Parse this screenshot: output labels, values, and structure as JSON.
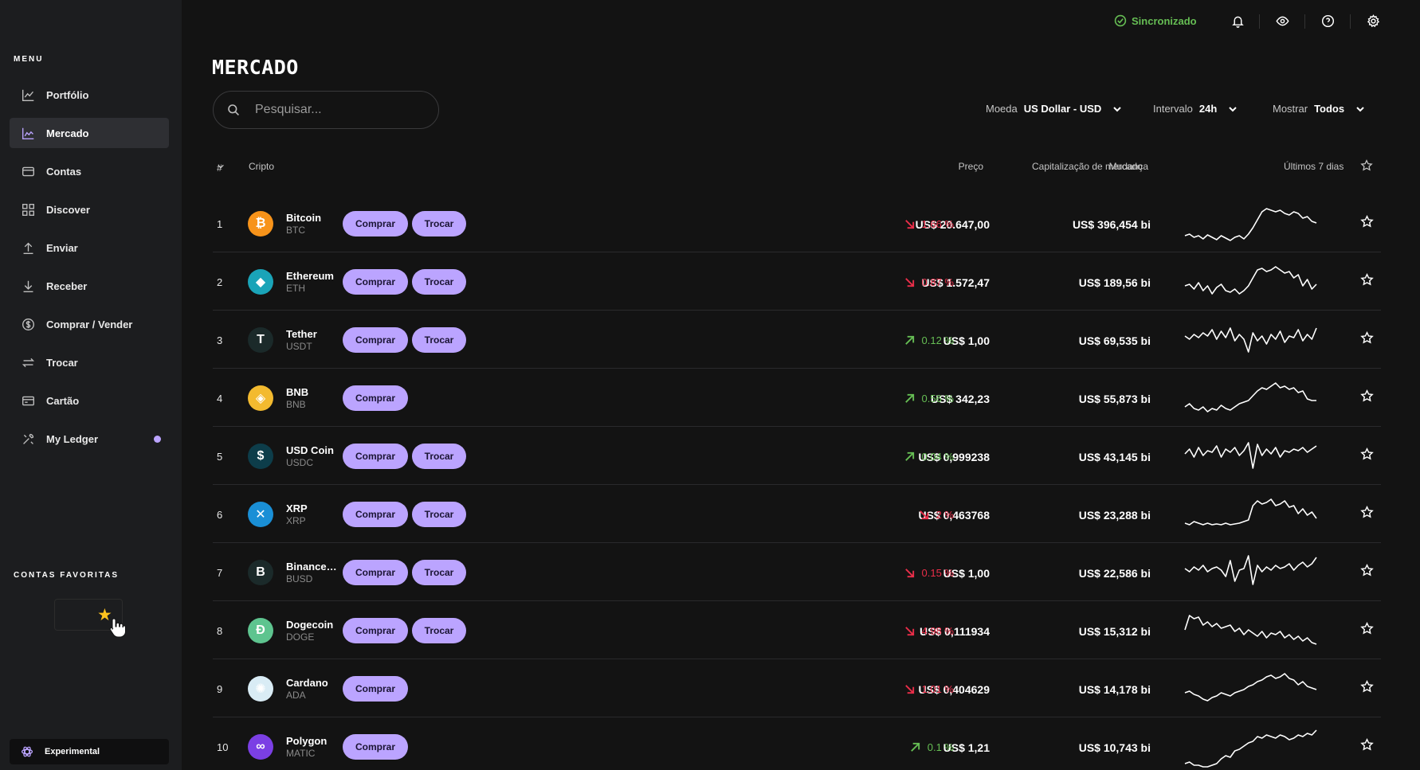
{
  "colors": {
    "accent": "#bba4ff",
    "up": "#66be54",
    "down": "#ea2e49",
    "background": "#131313",
    "sidebar": "#1c1d1f"
  },
  "sidebar": {
    "menu_title": "MENU",
    "items": [
      {
        "label": "Portfólio",
        "icon": "chart-line-icon"
      },
      {
        "label": "Mercado",
        "icon": "market-chart-icon"
      },
      {
        "label": "Contas",
        "icon": "wallet-icon"
      },
      {
        "label": "Discover",
        "icon": "grid-icon"
      },
      {
        "label": "Enviar",
        "icon": "arrow-up-icon"
      },
      {
        "label": "Receber",
        "icon": "arrow-down-icon"
      },
      {
        "label": "Comprar / Vender",
        "icon": "dollar-circle-icon"
      },
      {
        "label": "Trocar",
        "icon": "swap-icon"
      },
      {
        "label": "Cartão",
        "icon": "card-icon"
      },
      {
        "label": "My Ledger",
        "icon": "tools-icon"
      }
    ],
    "favorites_title": "CONTAS FAVORITAS",
    "experimental_label": "Experimental"
  },
  "topbar": {
    "sync_label": "Sincronizado"
  },
  "main": {
    "title": "MERCADO",
    "search_placeholder": "Pesquisar...",
    "filters": {
      "currency_label": "Moeda",
      "currency_value": "US Dollar - USD",
      "interval_label": "Intervalo",
      "interval_value": "24h",
      "show_label": "Mostrar",
      "show_value": "Todos"
    },
    "columns": {
      "rank": "#",
      "crypto": "Cripto",
      "price": "Preço",
      "change": "Mudança",
      "market_cap": "Capitalização de mercado",
      "last7": "Últimos 7 dias"
    },
    "buy_label": "Comprar",
    "swap_label": "Trocar"
  },
  "rows": [
    {
      "rank": "1",
      "name": "Bitcoin",
      "ticker": "BTC",
      "price": "US$ 20.647,00",
      "change": "1.66 %",
      "dir": "down",
      "cap": "US$ 396,454 bi",
      "swap": true,
      "icon_bg": "#f7931a",
      "glyph": "₿",
      "spark": [
        40,
        38,
        42,
        40,
        44,
        39,
        42,
        45,
        40,
        43,
        46,
        42,
        40,
        44,
        38,
        30,
        20,
        10,
        6,
        8,
        10,
        8,
        12,
        14,
        10,
        12,
        18,
        16,
        22,
        24
      ]
    },
    {
      "rank": "2",
      "name": "Ethereum",
      "ticker": "ETH",
      "price": "US$ 1.572,47",
      "change": "0.87 %",
      "dir": "down",
      "cap": "US$ 189,56 bi",
      "swap": true,
      "icon_bg": "#1aa4b8",
      "glyph": "◆",
      "spark": [
        30,
        28,
        34,
        26,
        36,
        30,
        40,
        32,
        28,
        36,
        38,
        34,
        40,
        36,
        30,
        20,
        10,
        8,
        12,
        10,
        6,
        10,
        14,
        12,
        20,
        16,
        30,
        22,
        34,
        28
      ]
    },
    {
      "rank": "3",
      "name": "Tether",
      "ticker": "USDT",
      "price": "US$ 1,00",
      "change": "0.12 %",
      "dir": "up",
      "cap": "US$ 69,535 bi",
      "swap": true,
      "icon_bg": "#1b2a2a",
      "glyph": "T",
      "spark": [
        20,
        24,
        18,
        22,
        16,
        20,
        12,
        24,
        14,
        22,
        10,
        26,
        18,
        24,
        40,
        16,
        26,
        20,
        30,
        18,
        24,
        14,
        28,
        20,
        22,
        12,
        26,
        18,
        24,
        10
      ]
    },
    {
      "rank": "4",
      "name": "BNB",
      "ticker": "BNB",
      "price": "US$ 342,23",
      "change": "0.56 %",
      "dir": "up",
      "cap": "US$ 55,873 bi",
      "swap": false,
      "icon_bg": "#f3ba2f",
      "glyph": "◈",
      "spark": [
        36,
        32,
        38,
        40,
        36,
        42,
        38,
        40,
        34,
        38,
        40,
        36,
        32,
        30,
        28,
        22,
        16,
        12,
        14,
        10,
        6,
        12,
        10,
        14,
        12,
        18,
        16,
        26,
        28,
        28
      ]
    },
    {
      "rank": "5",
      "name": "USD Coin",
      "ticker": "USDC",
      "price": "US$ 0,999238",
      "change": "0.04 %",
      "dir": "up",
      "cap": "US$ 43,145 bi",
      "swap": true,
      "icon_bg": "#0d3d4a",
      "glyph": "$",
      "spark": [
        22,
        16,
        26,
        14,
        24,
        18,
        20,
        12,
        26,
        16,
        20,
        14,
        24,
        18,
        8,
        40,
        10,
        24,
        16,
        22,
        14,
        26,
        18,
        20,
        16,
        18,
        14,
        20,
        16,
        12
      ]
    },
    {
      "rank": "6",
      "name": "XRP",
      "ticker": "XRP",
      "price": "US$ 0,463768",
      "change": "2 %",
      "dir": "down",
      "cap": "US$ 23,288 bi",
      "swap": true,
      "icon_bg": "#1a8fd6",
      "glyph": "✕",
      "spark": [
        36,
        38,
        34,
        36,
        38,
        36,
        38,
        37,
        38,
        36,
        38,
        37,
        36,
        34,
        32,
        14,
        8,
        12,
        10,
        6,
        14,
        12,
        8,
        16,
        14,
        24,
        18,
        26,
        22,
        30
      ]
    },
    {
      "rank": "7",
      "name": "Binance USD",
      "ticker": "BUSD",
      "price": "US$ 1,00",
      "change": "0.15 %",
      "dir": "down",
      "cap": "US$ 22,586 bi",
      "swap": true,
      "icon_bg": "#1b2a2a",
      "glyph": "B",
      "spark": [
        20,
        24,
        18,
        22,
        16,
        24,
        20,
        18,
        22,
        30,
        10,
        36,
        22,
        20,
        4,
        40,
        16,
        24,
        18,
        22,
        16,
        20,
        18,
        14,
        22,
        16,
        12,
        18,
        14,
        6
      ]
    },
    {
      "rank": "8",
      "name": "Dogecoin",
      "ticker": "DOGE",
      "price": "US$ 0,111934",
      "change": "4.98 %",
      "dir": "down",
      "cap": "US$ 15,312 bi",
      "swap": true,
      "icon_bg": "#5ec48f",
      "glyph": "Ð",
      "spark": [
        24,
        6,
        10,
        8,
        18,
        14,
        20,
        16,
        22,
        20,
        18,
        26,
        22,
        30,
        24,
        28,
        32,
        26,
        34,
        28,
        30,
        26,
        34,
        30,
        36,
        32,
        38,
        34,
        40,
        42
      ]
    },
    {
      "rank": "9",
      "name": "Cardano",
      "ticker": "ADA",
      "price": "US$ 0,404629",
      "change": "1.01 %",
      "dir": "down",
      "cap": "US$ 14,178 bi",
      "swap": false,
      "icon_bg": "#d9ecf5",
      "glyph": "✺",
      "spark": [
        30,
        28,
        32,
        34,
        38,
        40,
        36,
        34,
        30,
        32,
        34,
        30,
        28,
        26,
        22,
        20,
        16,
        14,
        10,
        8,
        12,
        10,
        6,
        12,
        14,
        20,
        16,
        22,
        24,
        26
      ]
    },
    {
      "rank": "10",
      "name": "Polygon",
      "ticker": "MATIC",
      "price": "US$ 1,21",
      "change": "0.1 %",
      "dir": "up",
      "cap": "US$ 10,743 bi",
      "swap": false,
      "icon_bg": "#7b3fe4",
      "glyph": "∞",
      "spark": [
        46,
        44,
        48,
        48,
        50,
        50,
        48,
        46,
        40,
        36,
        38,
        30,
        28,
        24,
        20,
        18,
        12,
        14,
        10,
        12,
        14,
        10,
        12,
        16,
        14,
        10,
        12,
        8,
        10,
        4
      ]
    }
  ]
}
